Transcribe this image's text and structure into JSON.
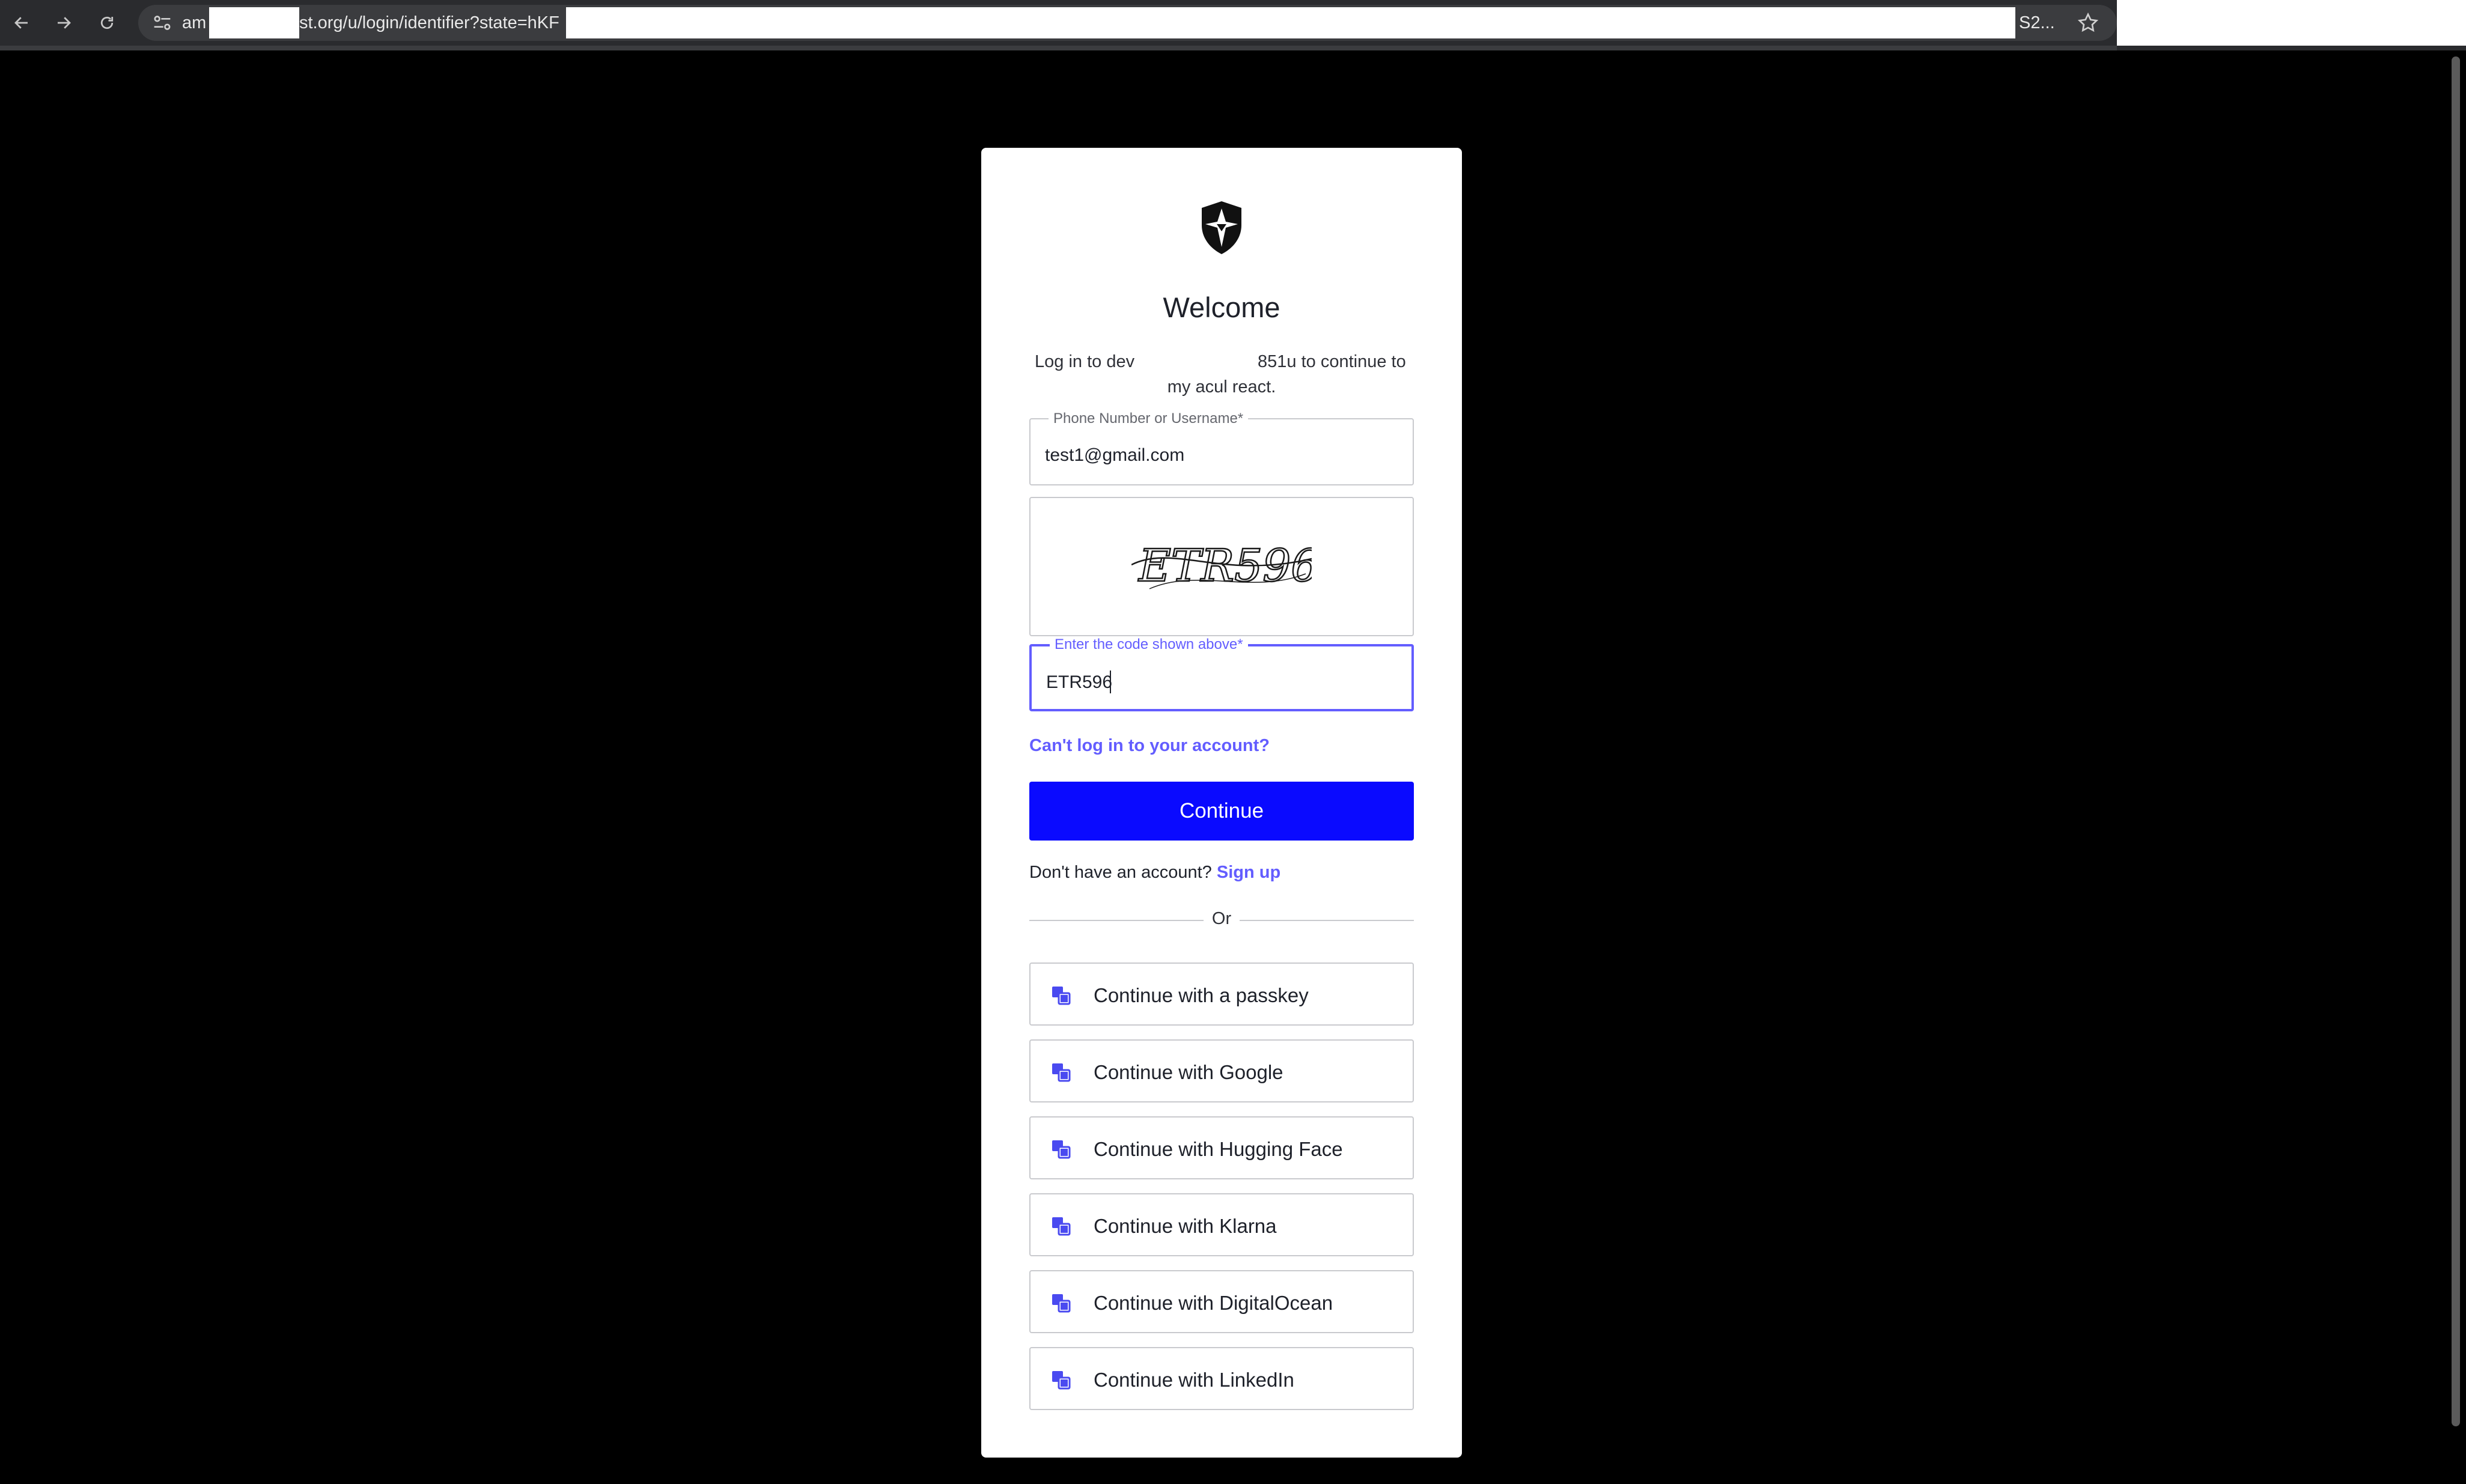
{
  "browser": {
    "url_prefix": "am",
    "url_middle": "st.org/u/login/identifier?state=hKF",
    "url_suffix": "S2..."
  },
  "login": {
    "title": "Welcome",
    "description_part1": "Log in to dev",
    "description_part2": "851u to continue to",
    "description_part3": "my acul react.",
    "username_label": "Phone Number or Username*",
    "username_value": "test1@gmail.com",
    "captcha_text": "ETR596",
    "captcha_label": "Enter the code shown above*",
    "captcha_value": "ETR596",
    "forgot_link": "Can't log in to your account?",
    "continue_button": "Continue",
    "signup_prompt": "Don't have an account?",
    "signup_link": "Sign up",
    "separator": "Or"
  },
  "social_providers": [
    {
      "label": "Continue with a passkey",
      "icon": "passkey-icon"
    },
    {
      "label": "Continue with Google",
      "icon": "google-icon"
    },
    {
      "label": "Continue with Hugging Face",
      "icon": "hugging-face-icon"
    },
    {
      "label": "Continue with Klarna",
      "icon": "klarna-icon"
    },
    {
      "label": "Continue with DigitalOcean",
      "icon": "digitalocean-icon"
    },
    {
      "label": "Continue with LinkedIn",
      "icon": "linkedin-icon"
    }
  ],
  "colors": {
    "brand_primary": "#0a0aff",
    "link": "#635dff",
    "focus": "#635dff",
    "social_icon": "#4a4af0"
  }
}
